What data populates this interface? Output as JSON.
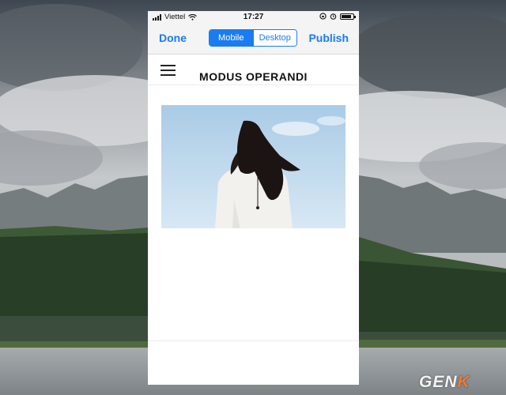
{
  "status_bar": {
    "carrier": "Viettel",
    "time": "17:27",
    "battery_level": 0.85
  },
  "editor_toolbar": {
    "done_label": "Done",
    "publish_label": "Publish",
    "view_modes": [
      "Mobile",
      "Desktop"
    ],
    "selected_view_mode": "Mobile"
  },
  "site": {
    "title": "MODUS OPERANDI"
  },
  "watermark": {
    "text_main": "GEN",
    "text_accent": "K"
  },
  "colors": {
    "accent": "#1a7cf0",
    "toolbar_bg": "#f4f4f5",
    "watermark_accent": "#ec7a3a"
  }
}
